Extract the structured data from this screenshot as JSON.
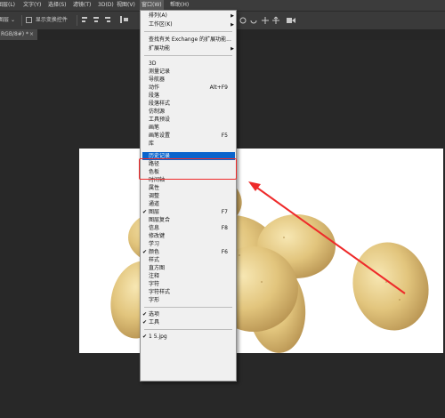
{
  "menubar": {
    "items": [
      {
        "label": "图层(L)"
      },
      {
        "label": "文字(Y)"
      },
      {
        "label": "选择(S)"
      },
      {
        "label": "滤镜(T)"
      },
      {
        "label": "3D(D)"
      },
      {
        "label": "视图(V)"
      },
      {
        "label": "窗口(W)"
      },
      {
        "label": "帮助(H)"
      }
    ]
  },
  "options_bar": {
    "mode_value": "图层",
    "show_transform_controls": "显示变换控件"
  },
  "document_tab": {
    "label": "RGB/8#) *",
    "close": "×"
  },
  "window_menu": {
    "items": [
      {
        "label": "排列(A)",
        "submenu": true
      },
      {
        "label": "工作区(K)",
        "submenu": true
      },
      {
        "label": "查找有关 Exchange 的扩展功能..."
      },
      {
        "label": "扩展功能",
        "submenu": true
      },
      {
        "label": "3D"
      },
      {
        "label": "测量记录"
      },
      {
        "label": "导航器"
      },
      {
        "label": "动作",
        "shortcut": "Alt+F9"
      },
      {
        "label": "段落"
      },
      {
        "label": "段落样式"
      },
      {
        "label": "仿制源"
      },
      {
        "label": "工具预设"
      },
      {
        "label": "画笔"
      },
      {
        "label": "画笔设置",
        "shortcut": "F5"
      },
      {
        "label": "库"
      },
      {
        "label": "历史记录",
        "highlighted": true
      },
      {
        "label": "路径"
      },
      {
        "label": "色板"
      },
      {
        "label": "时间轴"
      },
      {
        "label": "属性"
      },
      {
        "label": "调整"
      },
      {
        "label": "通道"
      },
      {
        "label": "图层",
        "shortcut": "F7",
        "checked": true
      },
      {
        "label": "图层复合"
      },
      {
        "label": "信息",
        "shortcut": "F8"
      },
      {
        "label": "修改键"
      },
      {
        "label": "学习"
      },
      {
        "label": "颜色",
        "shortcut": "F6",
        "checked": true
      },
      {
        "label": "样式"
      },
      {
        "label": "直方图"
      },
      {
        "label": "注释"
      },
      {
        "label": "字符"
      },
      {
        "label": "字符样式"
      },
      {
        "label": "字形"
      },
      {
        "label": "选项",
        "checked": true
      },
      {
        "label": "工具",
        "checked": true
      },
      {
        "label": "1 5.jpg",
        "checked": true
      }
    ],
    "submenu_arrow": "▶",
    "check_mark": "✔"
  },
  "colors": {
    "highlight": "#0a64cc",
    "annotation_red": "#ee2a2a",
    "potato_skin": "#e2c57d",
    "app_background": "#282828"
  }
}
